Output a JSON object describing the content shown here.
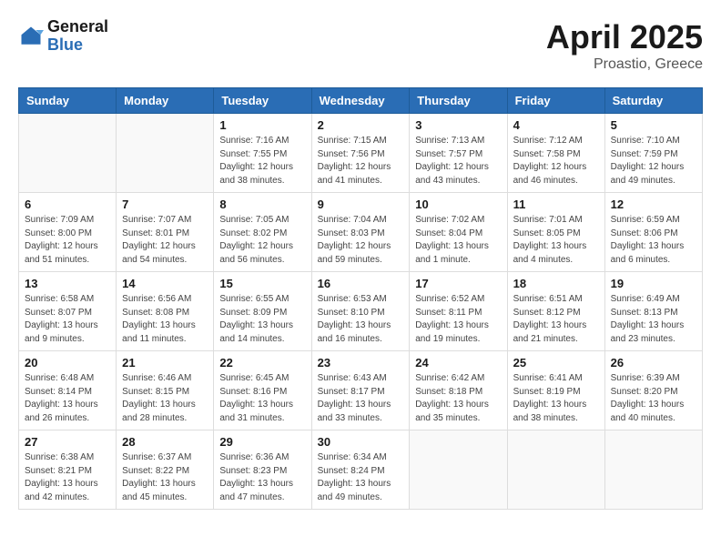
{
  "logo": {
    "general": "General",
    "blue": "Blue"
  },
  "title": {
    "month": "April 2025",
    "location": "Proastio, Greece"
  },
  "weekdays": [
    "Sunday",
    "Monday",
    "Tuesday",
    "Wednesday",
    "Thursday",
    "Friday",
    "Saturday"
  ],
  "weeks": [
    [
      {
        "day": "",
        "info": ""
      },
      {
        "day": "",
        "info": ""
      },
      {
        "day": "1",
        "info": "Sunrise: 7:16 AM\nSunset: 7:55 PM\nDaylight: 12 hours and 38 minutes."
      },
      {
        "day": "2",
        "info": "Sunrise: 7:15 AM\nSunset: 7:56 PM\nDaylight: 12 hours and 41 minutes."
      },
      {
        "day": "3",
        "info": "Sunrise: 7:13 AM\nSunset: 7:57 PM\nDaylight: 12 hours and 43 minutes."
      },
      {
        "day": "4",
        "info": "Sunrise: 7:12 AM\nSunset: 7:58 PM\nDaylight: 12 hours and 46 minutes."
      },
      {
        "day": "5",
        "info": "Sunrise: 7:10 AM\nSunset: 7:59 PM\nDaylight: 12 hours and 49 minutes."
      }
    ],
    [
      {
        "day": "6",
        "info": "Sunrise: 7:09 AM\nSunset: 8:00 PM\nDaylight: 12 hours and 51 minutes."
      },
      {
        "day": "7",
        "info": "Sunrise: 7:07 AM\nSunset: 8:01 PM\nDaylight: 12 hours and 54 minutes."
      },
      {
        "day": "8",
        "info": "Sunrise: 7:05 AM\nSunset: 8:02 PM\nDaylight: 12 hours and 56 minutes."
      },
      {
        "day": "9",
        "info": "Sunrise: 7:04 AM\nSunset: 8:03 PM\nDaylight: 12 hours and 59 minutes."
      },
      {
        "day": "10",
        "info": "Sunrise: 7:02 AM\nSunset: 8:04 PM\nDaylight: 13 hours and 1 minute."
      },
      {
        "day": "11",
        "info": "Sunrise: 7:01 AM\nSunset: 8:05 PM\nDaylight: 13 hours and 4 minutes."
      },
      {
        "day": "12",
        "info": "Sunrise: 6:59 AM\nSunset: 8:06 PM\nDaylight: 13 hours and 6 minutes."
      }
    ],
    [
      {
        "day": "13",
        "info": "Sunrise: 6:58 AM\nSunset: 8:07 PM\nDaylight: 13 hours and 9 minutes."
      },
      {
        "day": "14",
        "info": "Sunrise: 6:56 AM\nSunset: 8:08 PM\nDaylight: 13 hours and 11 minutes."
      },
      {
        "day": "15",
        "info": "Sunrise: 6:55 AM\nSunset: 8:09 PM\nDaylight: 13 hours and 14 minutes."
      },
      {
        "day": "16",
        "info": "Sunrise: 6:53 AM\nSunset: 8:10 PM\nDaylight: 13 hours and 16 minutes."
      },
      {
        "day": "17",
        "info": "Sunrise: 6:52 AM\nSunset: 8:11 PM\nDaylight: 13 hours and 19 minutes."
      },
      {
        "day": "18",
        "info": "Sunrise: 6:51 AM\nSunset: 8:12 PM\nDaylight: 13 hours and 21 minutes."
      },
      {
        "day": "19",
        "info": "Sunrise: 6:49 AM\nSunset: 8:13 PM\nDaylight: 13 hours and 23 minutes."
      }
    ],
    [
      {
        "day": "20",
        "info": "Sunrise: 6:48 AM\nSunset: 8:14 PM\nDaylight: 13 hours and 26 minutes."
      },
      {
        "day": "21",
        "info": "Sunrise: 6:46 AM\nSunset: 8:15 PM\nDaylight: 13 hours and 28 minutes."
      },
      {
        "day": "22",
        "info": "Sunrise: 6:45 AM\nSunset: 8:16 PM\nDaylight: 13 hours and 31 minutes."
      },
      {
        "day": "23",
        "info": "Sunrise: 6:43 AM\nSunset: 8:17 PM\nDaylight: 13 hours and 33 minutes."
      },
      {
        "day": "24",
        "info": "Sunrise: 6:42 AM\nSunset: 8:18 PM\nDaylight: 13 hours and 35 minutes."
      },
      {
        "day": "25",
        "info": "Sunrise: 6:41 AM\nSunset: 8:19 PM\nDaylight: 13 hours and 38 minutes."
      },
      {
        "day": "26",
        "info": "Sunrise: 6:39 AM\nSunset: 8:20 PM\nDaylight: 13 hours and 40 minutes."
      }
    ],
    [
      {
        "day": "27",
        "info": "Sunrise: 6:38 AM\nSunset: 8:21 PM\nDaylight: 13 hours and 42 minutes."
      },
      {
        "day": "28",
        "info": "Sunrise: 6:37 AM\nSunset: 8:22 PM\nDaylight: 13 hours and 45 minutes."
      },
      {
        "day": "29",
        "info": "Sunrise: 6:36 AM\nSunset: 8:23 PM\nDaylight: 13 hours and 47 minutes."
      },
      {
        "day": "30",
        "info": "Sunrise: 6:34 AM\nSunset: 8:24 PM\nDaylight: 13 hours and 49 minutes."
      },
      {
        "day": "",
        "info": ""
      },
      {
        "day": "",
        "info": ""
      },
      {
        "day": "",
        "info": ""
      }
    ]
  ]
}
